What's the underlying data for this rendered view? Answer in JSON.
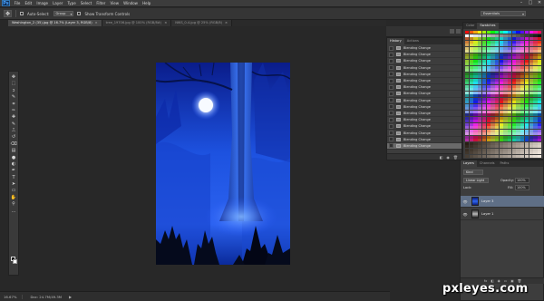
{
  "app": {
    "logo": "Ps"
  },
  "menu": {
    "items": [
      "File",
      "Edit",
      "Image",
      "Layer",
      "Type",
      "Select",
      "Filter",
      "View",
      "Window",
      "Help"
    ]
  },
  "window_controls": {
    "minimize": "–",
    "restore": "□",
    "close": "✕"
  },
  "options_bar": {
    "auto_select_label": "Auto-Select:",
    "auto_select_value": "Group",
    "transform_label": "Show Transform Controls",
    "workspace": "Essentials"
  },
  "tabs": [
    {
      "label": "Washington_2 (35).jpg @ 16.7% (Layer 3, RGB/8)",
      "active": true
    },
    {
      "label": "tree_19706.jpg @ 100% (RGB/8#)",
      "active": false
    },
    {
      "label": "NIKS_0-4.jpg @ 25% (RGB/8)",
      "active": false
    }
  ],
  "tools": {
    "icons": [
      "move-icon",
      "marquee-icon",
      "lasso-icon",
      "quick-select-icon",
      "crop-icon",
      "eyedropper-icon",
      "healing-icon",
      "brush-icon",
      "stamp-icon",
      "history-brush-icon",
      "eraser-icon",
      "gradient-icon",
      "blur-icon",
      "dodge-icon",
      "pen-icon",
      "type-icon",
      "path-select-icon",
      "shape-icon",
      "hand-icon",
      "zoom-icon",
      "more-icon"
    ],
    "glyphs": [
      "✥",
      "⬚",
      "ↄ",
      "✎",
      "⌗",
      "✑",
      "✚",
      "✎",
      "⎍",
      "↺",
      "⌫",
      "▤",
      "●",
      "◐",
      "✒",
      "T",
      "➤",
      "▭",
      "✋",
      "⚲",
      "…"
    ],
    "foreground_color": "#000000",
    "background_color": "#ffffff"
  },
  "history": {
    "tabs": [
      "History",
      "Actions"
    ],
    "items": [
      "Blending Change",
      "Blending Change",
      "Blending Change",
      "Blending Change",
      "Blending Change",
      "Blending Change",
      "Blending Change",
      "Blending Change",
      "Blending Change",
      "Blending Change",
      "Blending Change",
      "Blending Change",
      "Blending Change",
      "Blending Change",
      "Blending Change",
      "Blending Change"
    ],
    "active_index": 15,
    "footer_icons": [
      "◧",
      "◉",
      "🗑"
    ]
  },
  "swatches": {
    "tabs": [
      "Color",
      "Swatches"
    ]
  },
  "layers": {
    "tabs": [
      "Layers",
      "Channels",
      "Paths"
    ],
    "kind_label": "Kind",
    "blend_mode": "Linear Light",
    "opacity_label": "Opacity:",
    "opacity_value": "100%",
    "lock_label": "Lock:",
    "fill_label": "Fill:",
    "fill_value": "100%",
    "rows": [
      {
        "name": "Layer 3",
        "active": true
      },
      {
        "name": "Layer 1",
        "active": false
      }
    ],
    "footer_icons": [
      "fx",
      "◧",
      "◉",
      "▭",
      "▣",
      "🗑"
    ]
  },
  "status": {
    "zoom": "16.67%",
    "doc": "Doc: 24.7M/49.3M",
    "arrow": "▶"
  },
  "watermark": "pxleyes.com",
  "colors": {
    "sky_dark": "#06155a",
    "sky_mid": "#1a4ad0",
    "moon": "#f4f8ff",
    "tree_glow": "#3f7dff"
  }
}
